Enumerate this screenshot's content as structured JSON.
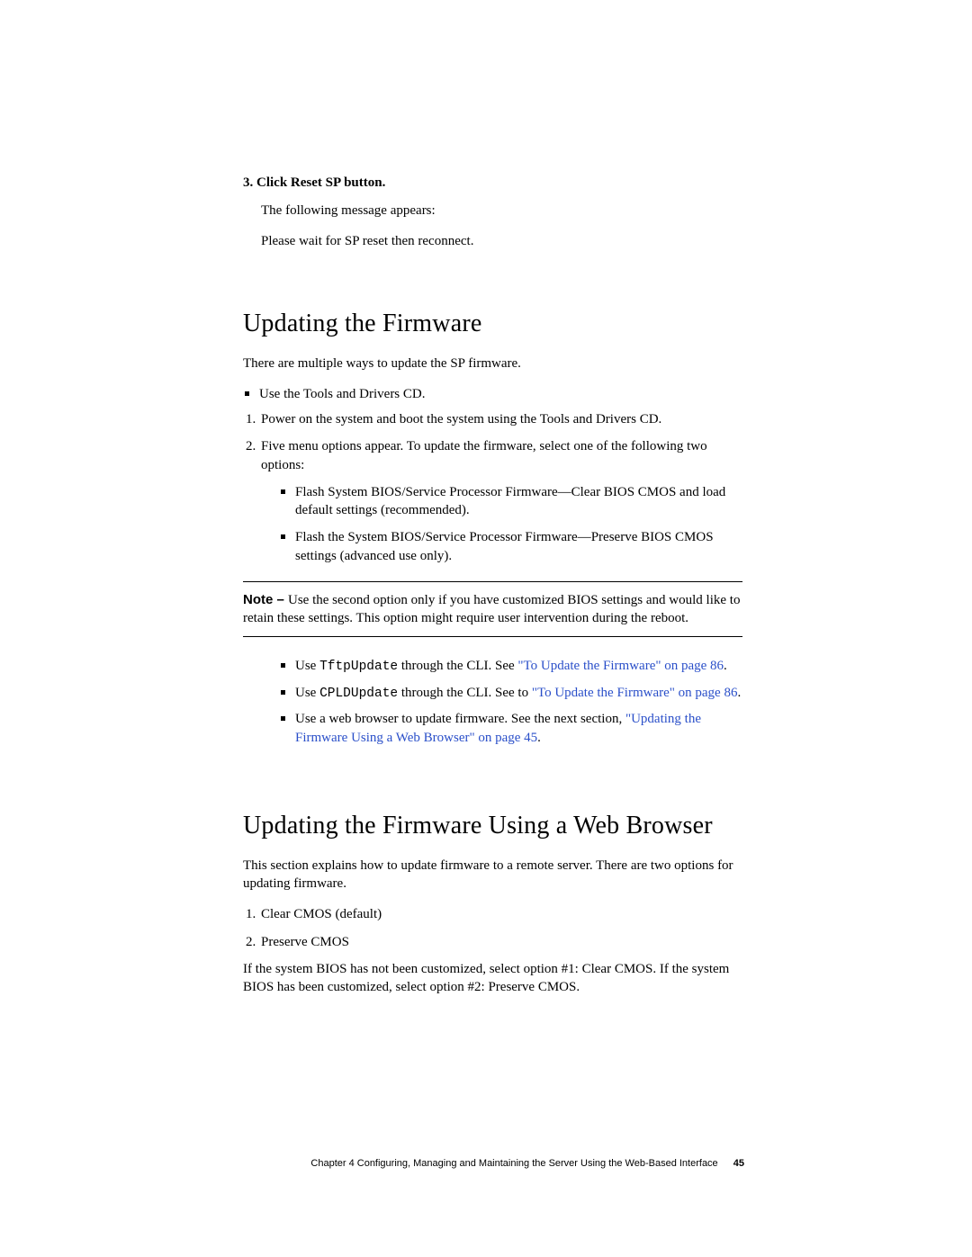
{
  "step3": {
    "number": "3.",
    "title": "Click Reset SP button.",
    "line1": "The following message appears:",
    "line2": "Please wait for SP reset then reconnect."
  },
  "section1": {
    "heading": "Updating the Firmware",
    "intro": "There are multiple ways to update the SP firmware.",
    "bullet1": "Use the Tools and Drivers CD.",
    "ol1": "Power on the system and boot the system using the Tools and Drivers CD.",
    "ol2": "Five menu options appear. To update the firmware, select one of the following two options:",
    "sub1": "Flash System BIOS/Service Processor Firmware—Clear BIOS CMOS and load default settings (recommended).",
    "sub2": "Flash the System BIOS/Service Processor Firmware—Preserve BIOS CMOS settings (advanced use only).",
    "note_label": "Note – ",
    "note_body": "Use the second option only if you have customized BIOS settings and would like to retain these settings. This option might require user intervention during the reboot.",
    "after1_pre": "Use ",
    "after1_code": "TftpUpdate",
    "after1_mid": " through the CLI. See ",
    "after1_link": "\"To Update the Firmware\" on page 86",
    "after1_post": ".",
    "after2_pre": "Use ",
    "after2_code": "CPLDUpdate",
    "after2_mid": " through the CLI. See to ",
    "after2_link": "\"To Update the Firmware\" on page 86",
    "after2_post": ".",
    "after3_pre": "Use a web browser to update firmware. See the next section, ",
    "after3_link": "\"Updating the Firmware Using a Web Browser\" on page 45",
    "after3_post": "."
  },
  "section2": {
    "heading": "Updating the Firmware Using a Web Browser",
    "intro": "This section explains how to update firmware to a remote server. There are two options for updating firmware.",
    "ol1": "Clear CMOS (default)",
    "ol2": "Preserve CMOS",
    "closing": "If the system BIOS has not been customized, select option #1: Clear CMOS. If the system BIOS has been customized, select option #2: Preserve CMOS."
  },
  "footer": {
    "chapter": "Chapter 4    Configuring, Managing and Maintaining the Server Using the Web-Based Interface",
    "page": "45"
  }
}
